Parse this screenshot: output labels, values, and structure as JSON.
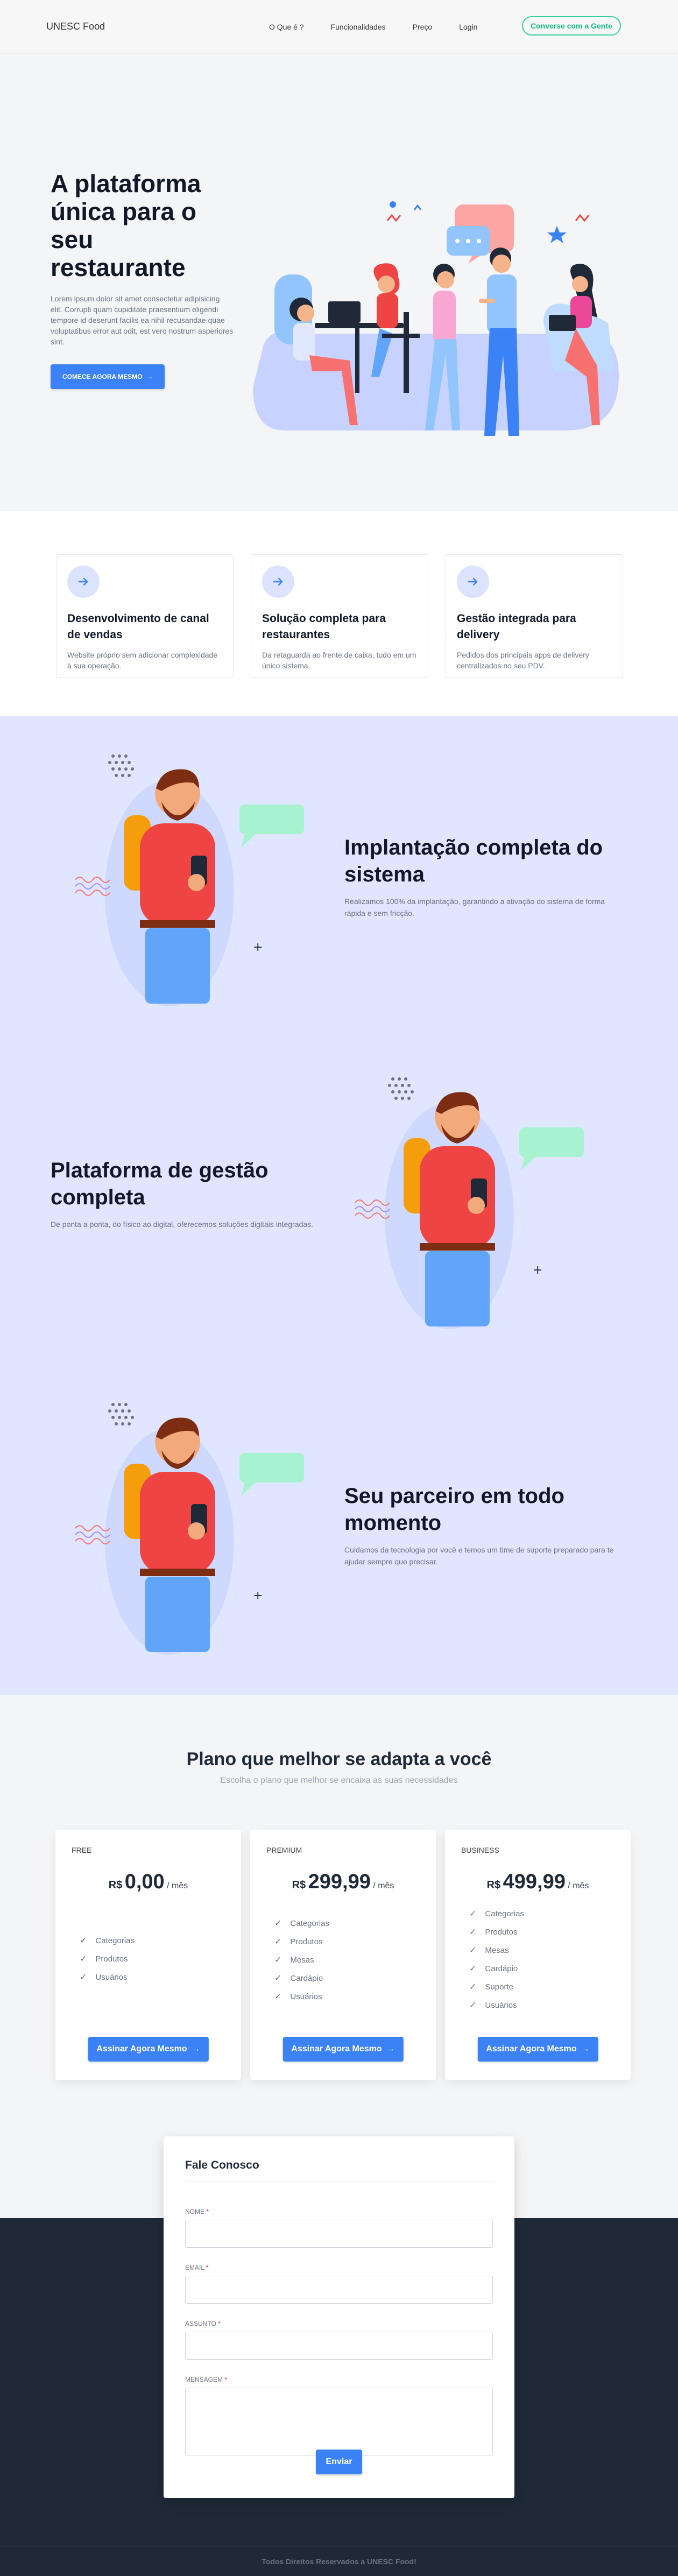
{
  "nav": {
    "brand": "UNESC Food",
    "links": [
      "O Que é ?",
      "Funcionalidades",
      "Preço",
      "Login"
    ],
    "cta": "Converse com a Gente"
  },
  "hero": {
    "title": "A plataforma única para o seu restaurante",
    "description": "Lorem ipsum dolor sit amet consectetur adipisicing elit. Corrupti quam cupiditate praesentium eligendi tempore id deserunt facilis ea nihil recusandae quae voluptatibus error aut odit, est vero nostrum asperiores sint.",
    "button": "COMECE AGORA MESMO"
  },
  "features": [
    {
      "title": "Desenvolvimento de canal de vendas",
      "description": "Website próprio sem adicionar complexidade à sua operação."
    },
    {
      "title": "Solução completa para restaurantes",
      "description": "Da retaguarda ao frente de caixa, tudo em um único sistema."
    },
    {
      "title": "Gestão integrada para delivery",
      "description": "Pedidos dos principais apps de delivery centralizados no seu PDV."
    }
  ],
  "showcase": [
    {
      "title": "Implantação completa do sistema",
      "description": "Realizamos 100% da implantação, garantindo a ativação do sistema de forma rápida e sem fricção."
    },
    {
      "title": "Plataforma de gestão completa",
      "description": "De ponta a ponta, do físico ao digital, oferecemos soluções digitais integradas."
    },
    {
      "title": "Seu parceiro em todo momento",
      "description": "Cuidamos da tecnologia por você e temos um time de suporte preparado para te ajudar sempre que precisar."
    }
  ],
  "pricing": {
    "title": "Plano que melhor se adapta a você",
    "subtitle": "Escolha o plano que melhor se encaixa as suas necessidades",
    "currency": "R$",
    "period": "/ mês",
    "button": "Assinar Agora Mesmo",
    "plans": [
      {
        "name": "FREE",
        "price": "0,00",
        "features": [
          "Categorias",
          "Produtos",
          "Usuários"
        ]
      },
      {
        "name": "PREMIUM",
        "price": "299,99",
        "features": [
          "Categorias",
          "Produtos",
          "Mesas",
          "Cardápio",
          "Usuários"
        ]
      },
      {
        "name": "BUSINESS",
        "price": "499,99",
        "features": [
          "Categorias",
          "Produtos",
          "Mesas",
          "Cardápio",
          "Suporte",
          "Usuários"
        ]
      }
    ]
  },
  "contact": {
    "title": "Fale Conosco",
    "name_label": "NOME",
    "email_label": "EMAIL",
    "subject_label": "ASSUNTO",
    "message_label": "MENSAGEM",
    "required_mark": "*",
    "send": "Enviar"
  },
  "footer": {
    "text": "Todos Direitos Reservados a UNESC Food!"
  },
  "colors": {
    "primary": "#3b82f6",
    "accent_green": "#10b981",
    "lavender": "#e0e6ff",
    "dark": "#1f2937"
  }
}
